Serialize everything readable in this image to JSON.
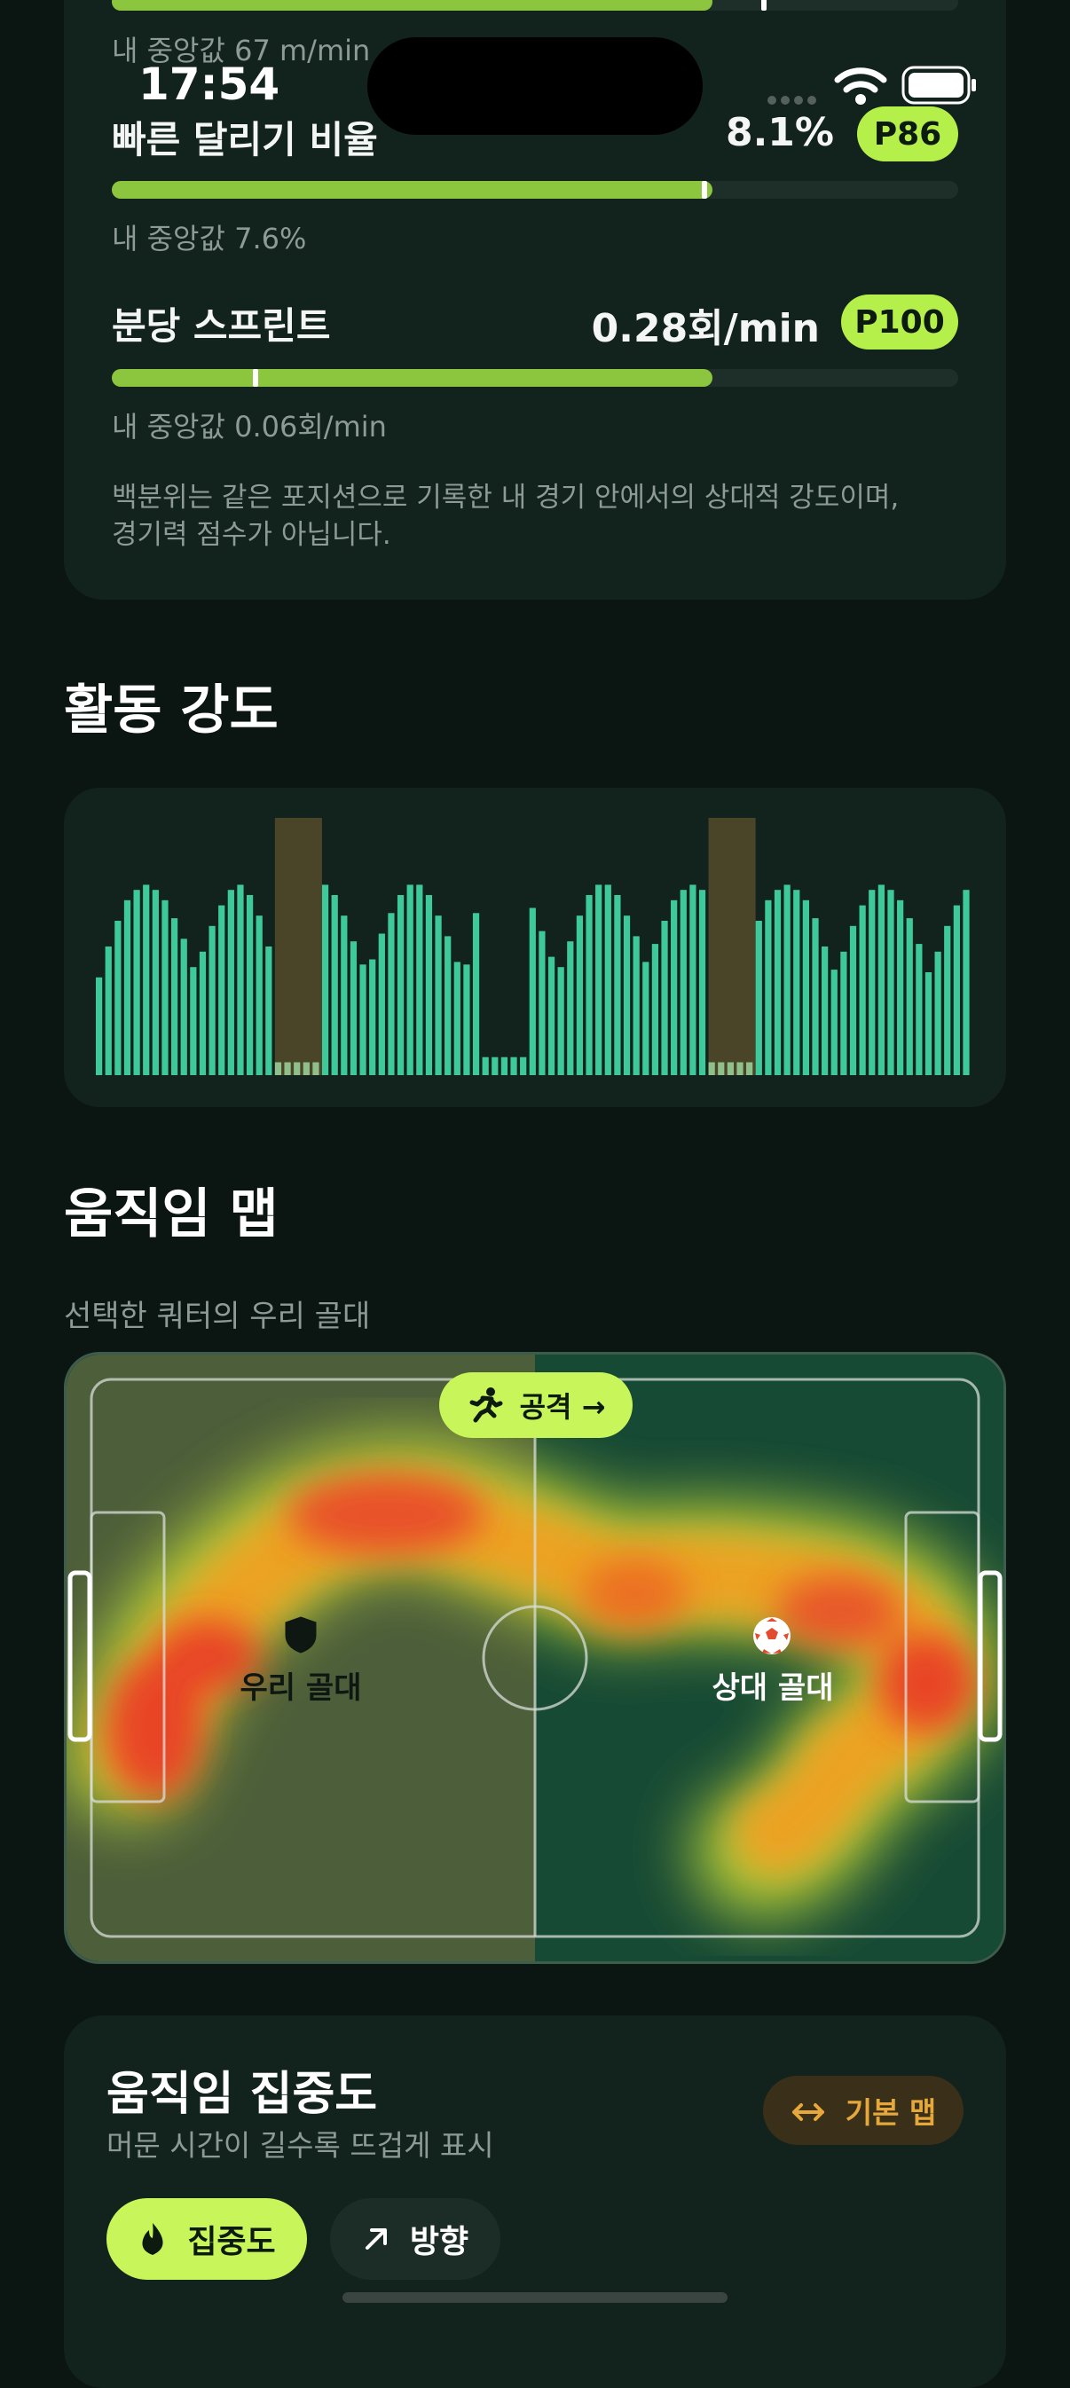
{
  "status_bar": {
    "time": "17:54"
  },
  "metrics_card": {
    "top_median": "내 중앙값 67 m/min",
    "top_metric_fill": 0.71,
    "top_metric_marker": 0.77,
    "rows": [
      {
        "label": "빠른 달리기 비율",
        "value": "8.1%",
        "percentile": "P86",
        "median": "내 중앙값 7.6%",
        "fill": 0.71,
        "marker": 0.7
      },
      {
        "label": "분당 스프린트",
        "value": "0.28회/min",
        "percentile": "P100",
        "median": "내 중앙값 0.06회/min",
        "fill": 0.71,
        "marker": 0.17
      }
    ],
    "note": "백분위는 같은 포지션으로 기록한 내 경기 안에서의 상대적 강도이며, 경기력 점수가 아닙니다."
  },
  "activity": {
    "title": "활동 강도",
    "colors": {
      "bar": "#3ec99a",
      "highlight": "#4a4428",
      "muted": "#8fbf8a"
    }
  },
  "chart_data": {
    "type": "bar",
    "title": "",
    "values": [
      0.38,
      0.5,
      0.6,
      0.68,
      0.72,
      0.74,
      0.72,
      0.68,
      0.61,
      0.53,
      0.42,
      0.48,
      0.58,
      0.66,
      0.72,
      0.74,
      0.7,
      0.62,
      0.5,
      0.05,
      0.05,
      0.05,
      0.05,
      0.05,
      0.74,
      0.7,
      0.62,
      0.52,
      0.43,
      0.45,
      0.55,
      0.63,
      0.7,
      0.74,
      0.74,
      0.7,
      0.62,
      0.54,
      0.44,
      0.43,
      0.63,
      0.07,
      0.07,
      0.07,
      0.07,
      0.07,
      0.65,
      0.56,
      0.46,
      0.42,
      0.52,
      0.62,
      0.7,
      0.74,
      0.74,
      0.7,
      0.62,
      0.54,
      0.44,
      0.51,
      0.6,
      0.68,
      0.72,
      0.74,
      0.72,
      0.05,
      0.05,
      0.05,
      0.05,
      0.05,
      0.6,
      0.68,
      0.72,
      0.74,
      0.72,
      0.68,
      0.61,
      0.5,
      0.41,
      0.48,
      0.58,
      0.66,
      0.72,
      0.74,
      0.72,
      0.68,
      0.61,
      0.51,
      0.4,
      0.48,
      0.58,
      0.66,
      0.72
    ],
    "highlight_ranges": [
      [
        19,
        23
      ],
      [
        65,
        69
      ]
    ],
    "ylim": [
      0,
      1
    ]
  },
  "movement_map": {
    "title": "움직임 맵",
    "subtitle": "선택한 쿼터의 우리 골대",
    "attack_label": "공격 →",
    "our_goal_label": "우리 골대",
    "opp_goal_label": "상대 골대"
  },
  "concentration": {
    "title": "움직임 집중도",
    "subtitle": "머문 시간이 길수록 뜨겁게 표시",
    "basic_map_label": "기본 맵",
    "tab_concentration": "집중도",
    "tab_direction": "방향"
  }
}
